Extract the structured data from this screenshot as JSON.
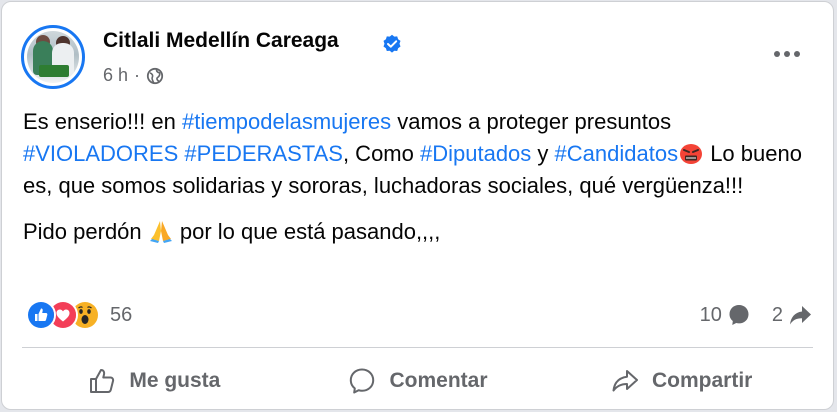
{
  "post": {
    "author": "Citlali Medellín Careaga",
    "time": "6 h",
    "separator": "·",
    "paragraph1": {
      "t1": "Es enserio!!! en ",
      "tag1": "#tiempodelasmujeres",
      "t2": " vamos a proteger presuntos ",
      "tag2": "#VIOLADORES",
      "t3": " ",
      "tag3": "#PEDERASTAS",
      "t4": ", Como ",
      "tag4": "#Diputados",
      "t5": " y ",
      "tag5": "#Candidatos",
      "t6": " Lo bueno es, que somos solidarias y sororas, luchadoras sociales, qué vergüenza!!!"
    },
    "paragraph2": {
      "t1": "Pido perdón ",
      "t2": " por lo que está pasando,,,,"
    }
  },
  "icons": {
    "verified": "verified-badge-icon",
    "audience": "globe-icon",
    "more": "more-options-icon",
    "angry_emoji": "angry-face-emoji",
    "pray_emoji": "folded-hands-emoji"
  },
  "reactions": {
    "types": [
      "like",
      "love",
      "wow"
    ],
    "count": "56"
  },
  "stats": {
    "comments": "10",
    "shares": "2"
  },
  "actions": {
    "like": "Me gusta",
    "comment": "Comentar",
    "share": "Compartir"
  },
  "colors": {
    "accent": "#1877f2",
    "secondary_text": "#65676b",
    "love": "#f33e58",
    "wow": "#f7b125"
  }
}
